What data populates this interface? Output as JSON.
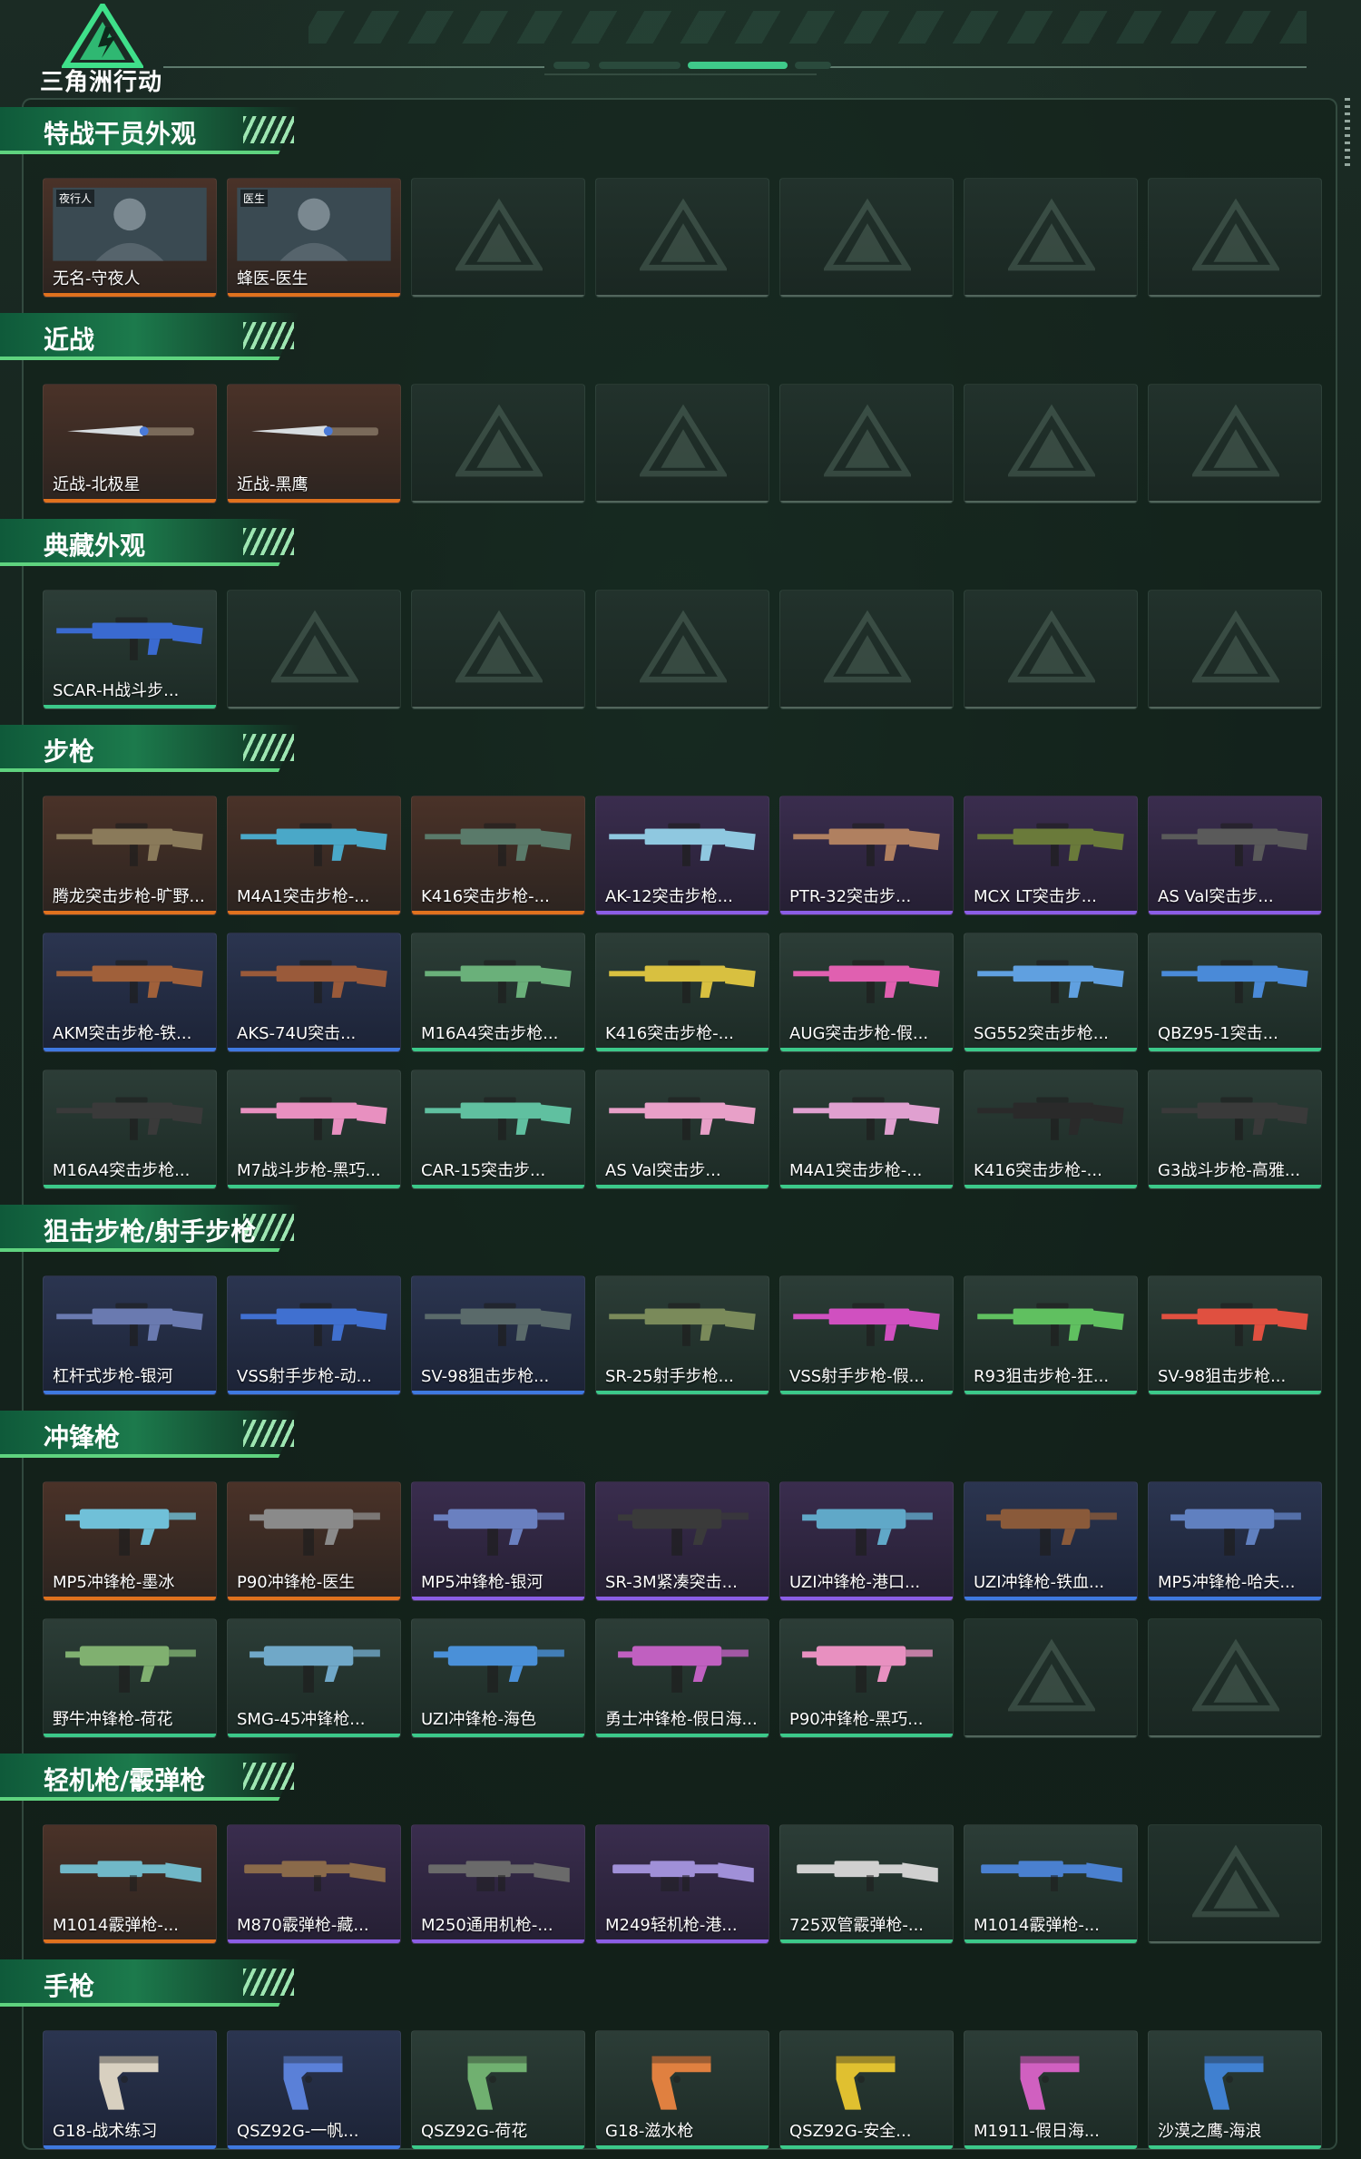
{
  "header": {
    "logo_text": "三角洲行动"
  },
  "colors": {
    "orange": "#e0721e",
    "purple": "#8b5ee6",
    "blue": "#3f79e0",
    "green": "#3cc98a",
    "banner": "#1c7a4c"
  },
  "sections": [
    {
      "title": "特战干员外观",
      "items": [
        {
          "label": "无名-守夜人",
          "quality": "orange",
          "icon": "operator-portrait",
          "tag": "夜行人"
        },
        {
          "label": "蜂医-医生",
          "quality": "orange",
          "icon": "operator-portrait",
          "tag": "医生"
        },
        null,
        null,
        null,
        null,
        null
      ]
    },
    {
      "title": "近战",
      "items": [
        {
          "label": "近战-北极星",
          "quality": "orange",
          "icon": "knife-icon"
        },
        {
          "label": "近战-黑鹰",
          "quality": "orange",
          "icon": "knife-icon"
        },
        null,
        null,
        null,
        null,
        null
      ]
    },
    {
      "title": "典藏外观",
      "items": [
        {
          "label": "SCAR-H战斗步...",
          "quality": "green",
          "icon": "rifle-icon",
          "tint": "#3a6ad0"
        },
        null,
        null,
        null,
        null,
        null,
        null
      ]
    },
    {
      "title": "步枪",
      "items": [
        {
          "label": "腾龙突击步枪-旷野...",
          "quality": "orange",
          "icon": "rifle-icon",
          "tint": "#8a7a5a"
        },
        {
          "label": "M4A1突击步枪-...",
          "quality": "orange",
          "icon": "rifle-icon",
          "tint": "#4aa8c8"
        },
        {
          "label": "K416突击步枪-...",
          "quality": "orange",
          "icon": "rifle-icon",
          "tint": "#5a7a6a"
        },
        {
          "label": "AK-12突击步枪...",
          "quality": "purple",
          "icon": "rifle-icon",
          "tint": "#8fc8e0"
        },
        {
          "label": "PTR-32突击步...",
          "quality": "purple",
          "icon": "rifle-icon",
          "tint": "#b08060"
        },
        {
          "label": "MCX LT突击步...",
          "quality": "purple",
          "icon": "rifle-icon",
          "tint": "#6a7a3a"
        },
        {
          "label": "AS Val突击步...",
          "quality": "purple",
          "icon": "rifle-icon",
          "tint": "#5a5a5a"
        },
        {
          "label": "AKM突击步枪-铁...",
          "quality": "blue",
          "icon": "rifle-icon",
          "tint": "#a0603a"
        },
        {
          "label": "AKS-74U突击...",
          "quality": "blue",
          "icon": "rifle-icon",
          "tint": "#9a5a3a"
        },
        {
          "label": "M16A4突击步枪...",
          "quality": "green",
          "icon": "rifle-icon",
          "tint": "#6ab07a"
        },
        {
          "label": "K416突击步枪-...",
          "quality": "green",
          "icon": "rifle-icon",
          "tint": "#d8c040"
        },
        {
          "label": "AUG突击步枪-假...",
          "quality": "green",
          "icon": "rifle-icon",
          "tint": "#e060b0"
        },
        {
          "label": "SG552突击步枪...",
          "quality": "green",
          "icon": "rifle-icon",
          "tint": "#60a0e0"
        },
        {
          "label": "QBZ95-1突击...",
          "quality": "green",
          "icon": "rifle-icon",
          "tint": "#4a8ad8"
        },
        {
          "label": "M16A4突击步枪...",
          "quality": "green",
          "icon": "rifle-icon",
          "tint": "#3a3a3a"
        },
        {
          "label": "M7战斗步枪-黑巧...",
          "quality": "green",
          "icon": "rifle-icon",
          "tint": "#e890c0"
        },
        {
          "label": "CAR-15突击步...",
          "quality": "green",
          "icon": "rifle-icon",
          "tint": "#60c0a0"
        },
        {
          "label": "AS Val突击步...",
          "quality": "green",
          "icon": "rifle-icon",
          "tint": "#e8a0c8"
        },
        {
          "label": "M4A1突击步枪-...",
          "quality": "green",
          "icon": "rifle-icon",
          "tint": "#e0a0d0"
        },
        {
          "label": "K416突击步枪-...",
          "quality": "green",
          "icon": "rifle-icon",
          "tint": "#2a2a2a"
        },
        {
          "label": "G3战斗步枪-高雅...",
          "quality": "green",
          "icon": "rifle-icon",
          "tint": "#3a3a3a"
        }
      ]
    },
    {
      "title": "狙击步枪/射手步枪",
      "items": [
        {
          "label": "杠杆式步枪-银河",
          "quality": "blue",
          "icon": "rifle-icon",
          "tint": "#6a7ab0"
        },
        {
          "label": "VSS射手步枪-动...",
          "quality": "blue",
          "icon": "rifle-icon",
          "tint": "#4070d0"
        },
        {
          "label": "SV-98狙击步枪...",
          "quality": "blue",
          "icon": "rifle-icon",
          "tint": "#5a6a6a"
        },
        {
          "label": "SR-25射手步枪...",
          "quality": "green",
          "icon": "rifle-icon",
          "tint": "#7a8a5a"
        },
        {
          "label": "VSS射手步枪-假...",
          "quality": "green",
          "icon": "rifle-icon",
          "tint": "#d050c0"
        },
        {
          "label": "R93狙击步枪-狂...",
          "quality": "green",
          "icon": "rifle-icon",
          "tint": "#60c060"
        },
        {
          "label": "SV-98狙击步枪...",
          "quality": "green",
          "icon": "rifle-icon",
          "tint": "#e05040"
        }
      ]
    },
    {
      "title": "冲锋枪",
      "items": [
        {
          "label": "MP5冲锋枪-墨冰",
          "quality": "orange",
          "icon": "smg-icon",
          "tint": "#70c0d8"
        },
        {
          "label": "P90冲锋枪-医生",
          "quality": "orange",
          "icon": "smg-icon",
          "tint": "#8a8a8a"
        },
        {
          "label": "MP5冲锋枪-银河",
          "quality": "purple",
          "icon": "smg-icon",
          "tint": "#6a80c0"
        },
        {
          "label": "SR-3M紧凑突击...",
          "quality": "purple",
          "icon": "smg-icon",
          "tint": "#3a3a3a"
        },
        {
          "label": "UZI冲锋枪-港口...",
          "quality": "purple",
          "icon": "smg-icon",
          "tint": "#60a8c8"
        },
        {
          "label": "UZI冲锋枪-铁血...",
          "quality": "blue",
          "icon": "smg-icon",
          "tint": "#8a5a3a"
        },
        {
          "label": "MP5冲锋枪-哈夫...",
          "quality": "blue",
          "icon": "smg-icon",
          "tint": "#6080c0"
        },
        {
          "label": "野牛冲锋枪-荷花",
          "quality": "green",
          "icon": "smg-icon",
          "tint": "#80b070"
        },
        {
          "label": "SMG-45冲锋枪...",
          "quality": "green",
          "icon": "smg-icon",
          "tint": "#70a8c8"
        },
        {
          "label": "UZI冲锋枪-海色",
          "quality": "green",
          "icon": "smg-icon",
          "tint": "#4a90d8"
        },
        {
          "label": "勇士冲锋枪-假日海...",
          "quality": "green",
          "icon": "smg-icon",
          "tint": "#c060c0"
        },
        {
          "label": "P90冲锋枪-黑巧...",
          "quality": "green",
          "icon": "smg-icon",
          "tint": "#e890c0"
        },
        null,
        null
      ]
    },
    {
      "title": "轻机枪/霰弹枪",
      "items": [
        {
          "label": "M1014霰弹枪-...",
          "quality": "orange",
          "icon": "shotgun-icon",
          "tint": "#70b8c8"
        },
        {
          "label": "M870霰弹枪-藏...",
          "quality": "purple",
          "icon": "shotgun-icon",
          "tint": "#8a6a4a"
        },
        {
          "label": "M250通用机枪-...",
          "quality": "purple",
          "icon": "mg-icon",
          "tint": "#6a6a6a"
        },
        {
          "label": "M249轻机枪-港...",
          "quality": "purple",
          "icon": "mg-icon",
          "tint": "#a090d8"
        },
        {
          "label": "725双管霰弹枪-...",
          "quality": "green",
          "icon": "shotgun-icon",
          "tint": "#d0d0d0"
        },
        {
          "label": "M1014霰弹枪-...",
          "quality": "green",
          "icon": "shotgun-icon",
          "tint": "#4a80d0"
        },
        null
      ]
    },
    {
      "title": "手枪",
      "items": [
        {
          "label": "G18-战术练习",
          "quality": "blue",
          "icon": "pistol-icon",
          "tint": "#d8d0c0"
        },
        {
          "label": "QSZ92G-一帆...",
          "quality": "blue",
          "icon": "pistol-icon",
          "tint": "#5a80d8"
        },
        {
          "label": "QSZ92G-荷花",
          "quality": "green",
          "icon": "pistol-icon",
          "tint": "#70b070"
        },
        {
          "label": "G18-滋水枪",
          "quality": "green",
          "icon": "pistol-icon",
          "tint": "#e08040"
        },
        {
          "label": "QSZ92G-安全...",
          "quality": "green",
          "icon": "pistol-icon",
          "tint": "#e0c030"
        },
        {
          "label": "M1911-假日海...",
          "quality": "green",
          "icon": "pistol-icon",
          "tint": "#d060c0"
        },
        {
          "label": "沙漠之鹰-海浪",
          "quality": "green",
          "icon": "pistol-icon",
          "tint": "#4080d0"
        }
      ]
    }
  ]
}
